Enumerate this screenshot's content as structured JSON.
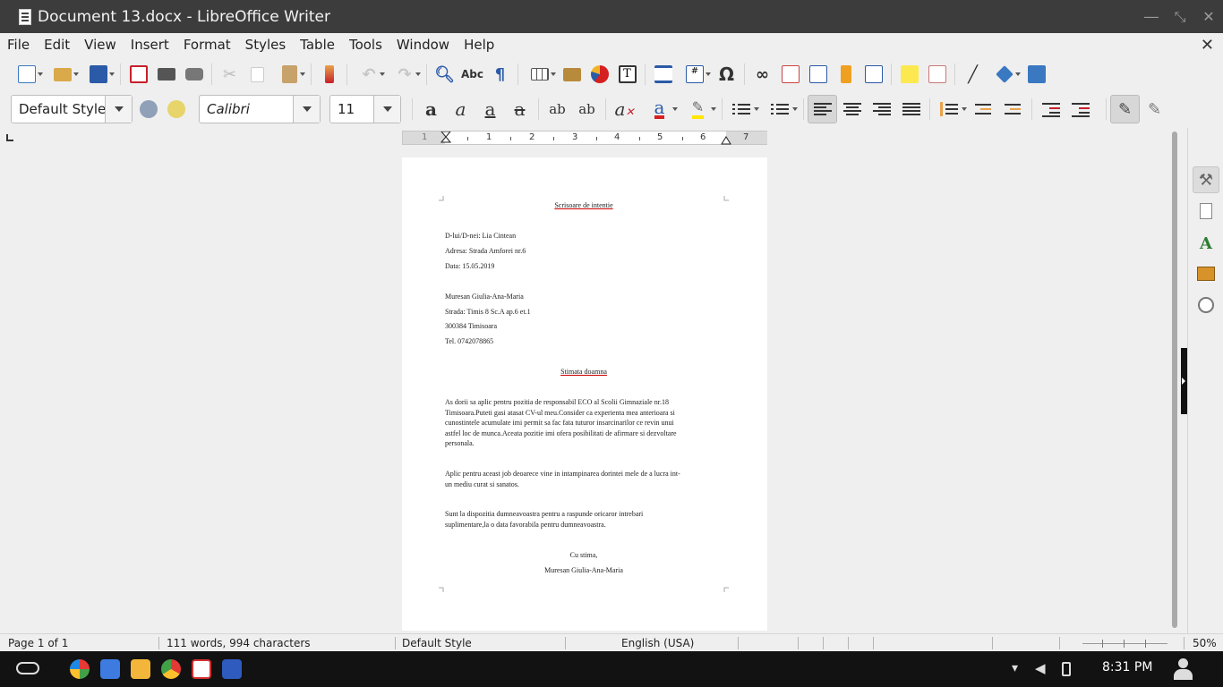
{
  "window": {
    "title": "Document 13.docx - LibreOffice Writer"
  },
  "menu": [
    "File",
    "Edit",
    "View",
    "Insert",
    "Format",
    "Styles",
    "Table",
    "Tools",
    "Window",
    "Help"
  ],
  "formatting": {
    "paragraph_style": "Default Style",
    "font_name": "Calibri",
    "font_size": "11"
  },
  "ruler": {
    "labels": [
      "1",
      "1",
      "2",
      "3",
      "4",
      "5",
      "6",
      "7"
    ]
  },
  "document": {
    "title": "Scrisoare de intentie",
    "recipient": "D-lui/D-nei: Lia Cintean",
    "recipient_address": "Adresa: Strada Amforei nr.6",
    "date": "Data:  15.05.2019",
    "sender_name": "Muresan Giulia-Ana-Maria",
    "sender_street": "Strada: Timis 8 Sc.A ap.6 et.1",
    "sender_city": "300384 Timisoara",
    "sender_phone": "Tel. 0742078865",
    "greeting": "Stimata doamna",
    "para1_line1": "As dorii sa aplic pentru pozitia de responsabil ECO al  Scolii Gimnaziale nr.18",
    "para1_line2": "Timisoara.Puteti gasi atasat CV-ul meu.Consider  ca experienta mea anterioara si",
    "para1_line3": "cunostintele acumulate imi permit sa fac fata tuturor insarcinarilor ce revin  unui",
    "para1_line4": "astfel loc de munca.Aceata pozitie imi ofera posibilitati de afirmare si dezvoltare",
    "para1_line5": "personala.",
    "para2_line1": "Aplic pentru aceast job deoarece vine in intampinarea dorintei mele de a lucra int-",
    "para2_line2": "un mediu curat si sanatos.",
    "para3_line1": "Sunt la dispozitia dumneavoastra pentru a raspunde oricaror intrebari",
    "para3_line2": "suplimentare,la o data favorabila pentru dumneavoastra.",
    "closing": "Cu stima,",
    "signature": "Muresan Giulia-Ana-Maria"
  },
  "status": {
    "page": "Page 1 of 1",
    "words": "111 words, 994 characters",
    "style": "Default Style",
    "language": "English (USA)",
    "zoom": "50%"
  },
  "taskbar": {
    "time": "8:31 PM"
  },
  "icons": {
    "new": "new-document-icon",
    "open": "open-folder-icon",
    "save": "save-icon",
    "pdf": "export-pdf-icon",
    "print": "print-icon",
    "preview": "print-preview-icon"
  },
  "colors": {
    "titlebar": "#3c3c3c",
    "font_color": "#d62020",
    "highlight": "#ffe600",
    "taskbar": "#121212"
  }
}
